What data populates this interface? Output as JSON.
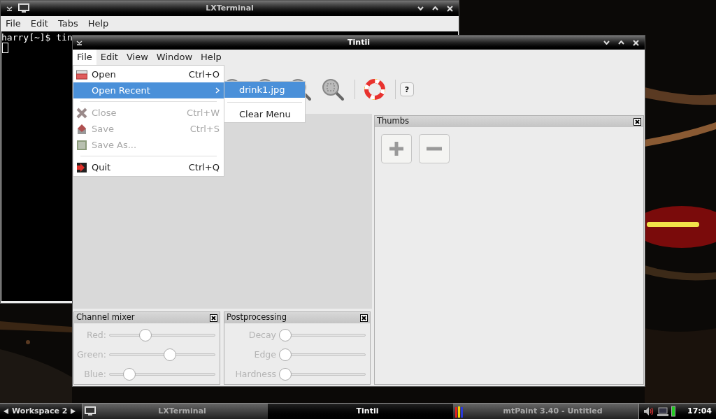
{
  "terminal_window": {
    "title": "LXTerminal",
    "menu": [
      "File",
      "Edit",
      "Tabs",
      "Help"
    ],
    "lines": [
      "harry[~]$ tin"
    ]
  },
  "tintii_window": {
    "title": "Tintii",
    "menu": [
      {
        "label": "File",
        "selected": true
      },
      {
        "label": "Edit",
        "selected": false
      },
      {
        "label": "View",
        "selected": false
      },
      {
        "label": "Window",
        "selected": false
      },
      {
        "label": "Help",
        "selected": false
      }
    ],
    "file_menu": [
      {
        "kind": "item",
        "label": "Open",
        "shortcut": "Ctrl+O",
        "disabled": false,
        "highlighted": false
      },
      {
        "kind": "submenu",
        "label": "Open Recent",
        "disabled": false,
        "highlighted": true
      },
      {
        "kind": "separator"
      },
      {
        "kind": "item",
        "label": "Close",
        "shortcut": "Ctrl+W",
        "disabled": true,
        "highlighted": false
      },
      {
        "kind": "item",
        "label": "Save",
        "shortcut": "Ctrl+S",
        "disabled": true,
        "highlighted": false
      },
      {
        "kind": "item",
        "label": "Save As...",
        "disabled": true,
        "highlighted": false
      },
      {
        "kind": "separator"
      },
      {
        "kind": "item",
        "label": "Quit",
        "shortcut": "Ctrl+Q",
        "disabled": false,
        "highlighted": false
      }
    ],
    "recent_menu": [
      {
        "kind": "item",
        "label": "drink1.jpg",
        "highlighted": true
      },
      {
        "kind": "separator"
      },
      {
        "kind": "item",
        "label": "Clear Menu",
        "highlighted": false
      }
    ],
    "help_button": "?",
    "thumbs_panel": {
      "title": "Thumbs"
    },
    "channel_mixer": {
      "title": "Channel mixer",
      "sliders": [
        {
          "label": "Red:",
          "level": 0.32,
          "disabled": true
        },
        {
          "label": "Green:",
          "level": 0.58,
          "disabled": true
        },
        {
          "label": "Blue:",
          "level": 0.15,
          "disabled": true
        }
      ]
    },
    "postprocessing": {
      "title": "Postprocessing",
      "sliders": [
        {
          "label": "Decay",
          "level": 0,
          "disabled": true
        },
        {
          "label": "Edge",
          "level": 0,
          "disabled": true
        },
        {
          "label": "Hardness",
          "level": 0,
          "disabled": true
        }
      ]
    }
  },
  "taskbar": {
    "workspace": "Workspace 2",
    "tasks": [
      {
        "label": "LXTerminal",
        "selected": false
      },
      {
        "label": "Tintii",
        "selected": true
      },
      {
        "label": "mtPaint 3.40 - Untitled",
        "selected": false
      }
    ],
    "clock": "17:04"
  }
}
